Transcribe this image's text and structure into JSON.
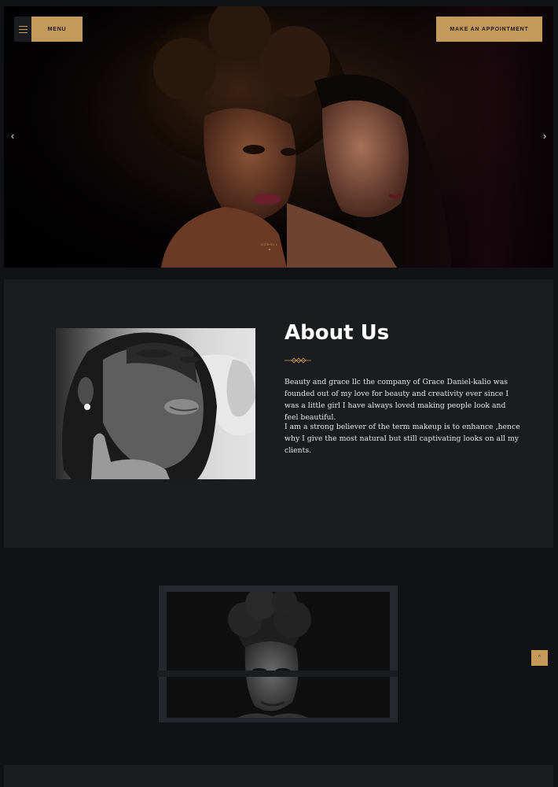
{
  "header": {
    "menu_label": "MENU",
    "appointment_label": "MAKE AN APPOINTMENT"
  },
  "hero": {
    "scroll_label": "SCROLL",
    "prev_icon": "chevron-left-icon",
    "next_icon": "chevron-right-icon"
  },
  "about": {
    "title": "About Us",
    "paragraph_1": "Beauty and grace llc the company of Grace Daniel-kalio was founded out of my love for beauty and creativity ever since I was a little girl I have always loved making people look and feel beautiful.",
    "paragraph_2": "I am a strong believer of the term makeup is to enhance ,hence why I give the most natural but still captivating looks on all my clients."
  },
  "back_to_top": {
    "icon": "chevron-up-icon",
    "symbol": "^"
  },
  "colors": {
    "accent": "#c4995a",
    "page_background": "#111215",
    "section_background": "#1a1c20"
  }
}
